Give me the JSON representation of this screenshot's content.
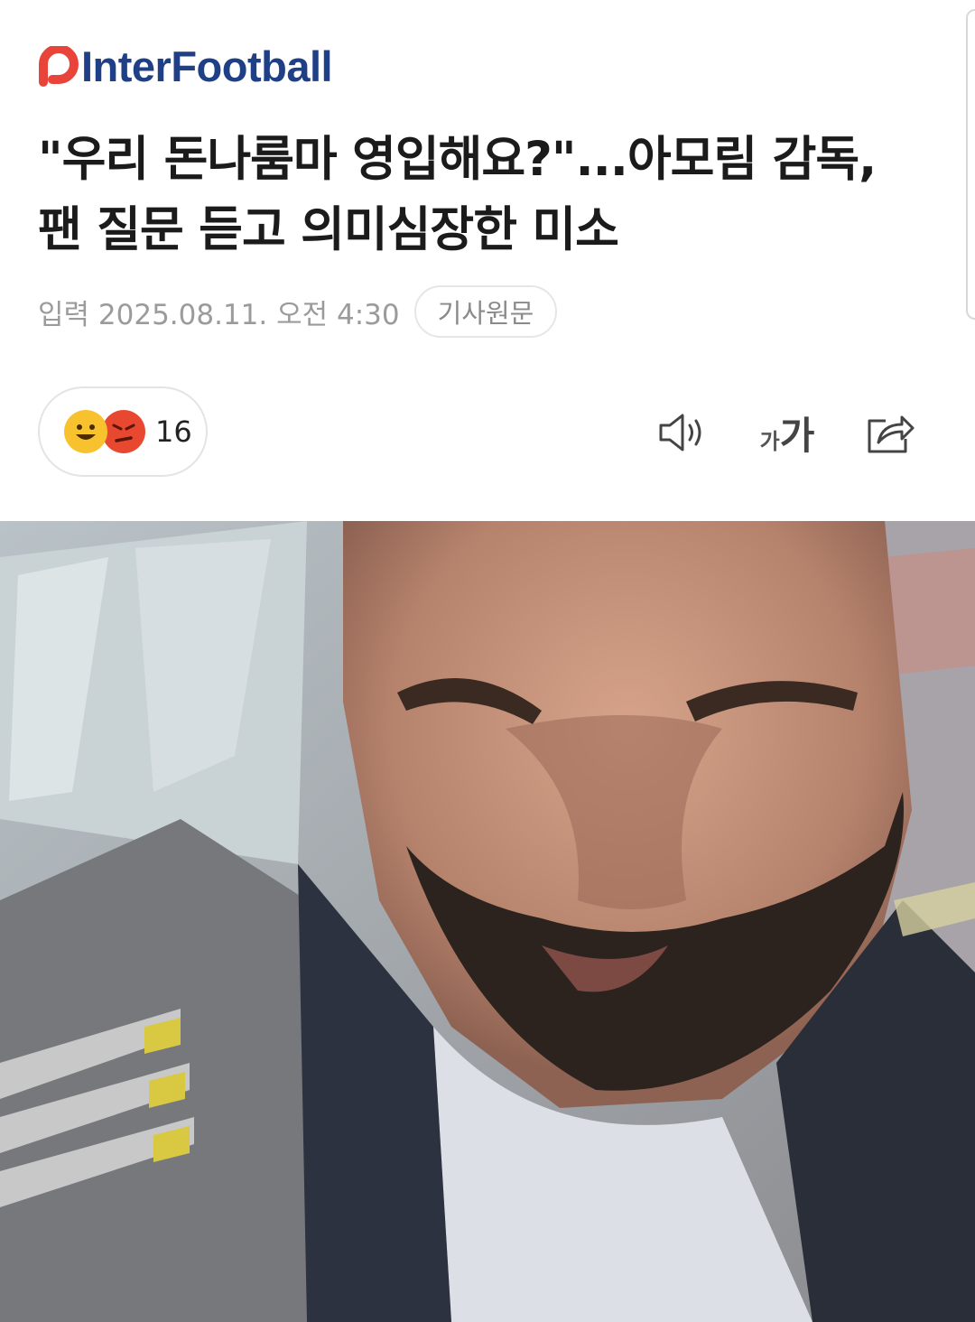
{
  "app": {
    "publisher": "InterFootball",
    "brand_colors": {
      "logo_red": "#e8443a",
      "logo_navy": "#1f3f86"
    }
  },
  "article": {
    "headline_line1": "\"우리 돈나룸마 영입해요?\"...아모림 감독,",
    "headline_line2": "팬 질문 듣고 의미심장한 미소",
    "published": "입력 2025.08.11. 오전 4:30",
    "source_button": "기사원문"
  },
  "reactions": {
    "icons": [
      "happy-emoji-icon",
      "angry-emoji-icon"
    ],
    "count": "16"
  },
  "toolbar": {
    "speaker_icon": "speaker-icon",
    "font_small": "가",
    "font_big": "가",
    "share_icon": "share-icon"
  },
  "photo": {
    "subject": "article-photo"
  }
}
